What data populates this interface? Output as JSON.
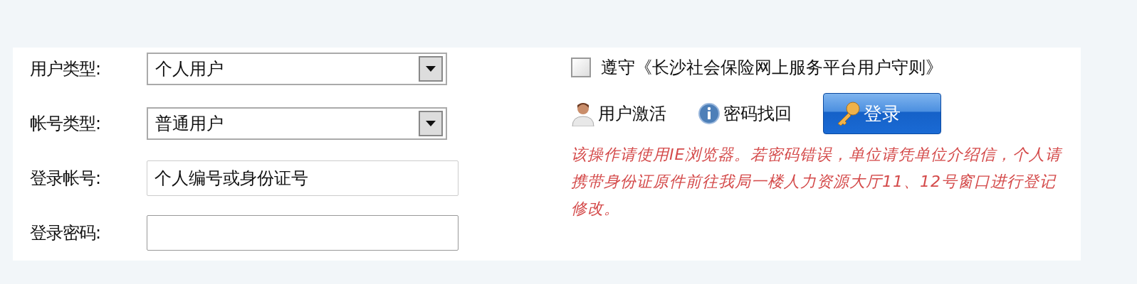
{
  "form": {
    "fields": [
      {
        "kind": "select",
        "label": "用户类型:",
        "value": "个人用户"
      },
      {
        "kind": "select",
        "label": "帐号类型:",
        "value": "普通用户"
      },
      {
        "kind": "text",
        "label": "登录帐号:",
        "value": "个人编号或身份证号"
      },
      {
        "kind": "password",
        "label": "登录密码:"
      }
    ]
  },
  "agreement": {
    "label": "遵守《长沙社会保险网上服务平台用户守则》",
    "checked": false
  },
  "links": [
    {
      "kind": "user",
      "label": "用户激活"
    },
    {
      "kind": "info",
      "label": "密码找回"
    }
  ],
  "login_button": {
    "label": "登录"
  },
  "notice": "该操作请使用IE浏览器。若密码错误，单位请凭单位介绍信，个人请携带身份证原件前往我局一楼人力资源大厅11、12号窗口进行登记修改。"
}
